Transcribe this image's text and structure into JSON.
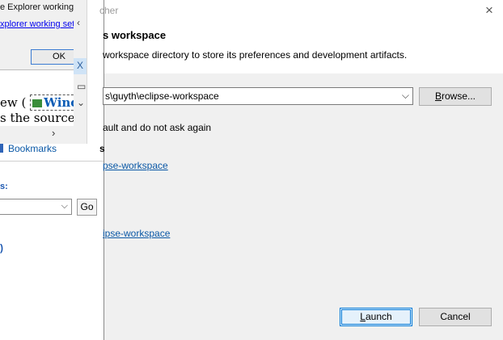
{
  "help_window": {
    "bookmarks_label": "Bookmarks",
    "scope_label": "s:",
    "go_label": "Go",
    "link_fragment": ")"
  },
  "alert_popup": {
    "line1": "e Explorer working",
    "line2": "xplorer working sets",
    "ok_label": "OK"
  },
  "side_strip": {
    "back_icon": "‹",
    "close_icon": "X",
    "restore_icon": "▭",
    "collapse_icon": "⌄"
  },
  "source_page": {
    "line1_prefix": "ew (",
    "line1_link": "Wind",
    "line2": "s the source o",
    "scroll_arrow": "›"
  },
  "dialog": {
    "title": "cher",
    "close_label": "×",
    "heading": "s workspace",
    "description": "workspace directory to store its preferences and development artifacts.",
    "workspace_value": "s\\guyth\\eclipse-workspace",
    "browse_label": "Browse...",
    "default_checkbox_label": "ault and do not ask again",
    "recent_heading": "s",
    "recent_links": [
      "pse-workspace",
      "ipse-workspace"
    ],
    "launch_label": "Launch",
    "cancel_label": "Cancel"
  },
  "colors": {
    "link": "#0a58a6",
    "dialog_body": "#f0f0f0",
    "focus_border": "#0078d7"
  }
}
